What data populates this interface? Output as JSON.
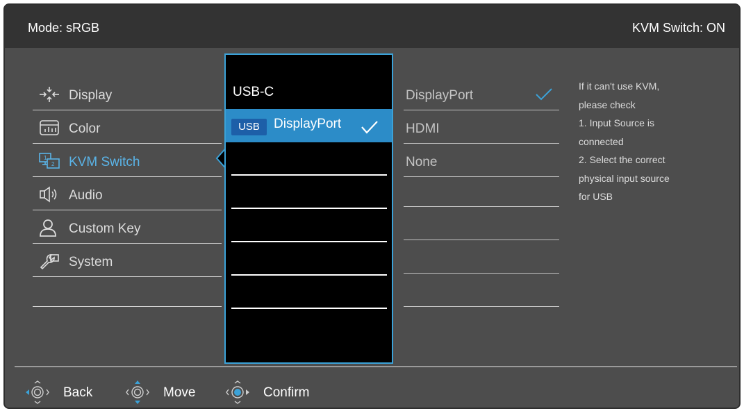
{
  "header": {
    "mode": "Mode: sRGB",
    "kvm_status": "KVM Switch: ON"
  },
  "menu": [
    {
      "label": "Display",
      "icon": "display-adjust-icon",
      "active": false
    },
    {
      "label": "Color",
      "icon": "color-icon",
      "active": false
    },
    {
      "label": "KVM Switch",
      "icon": "kvm-switch-icon",
      "active": true
    },
    {
      "label": "Audio",
      "icon": "speaker-icon",
      "active": false
    },
    {
      "label": "Custom Key",
      "icon": "person-icon",
      "active": false
    },
    {
      "label": "System",
      "icon": "wrench-icon",
      "active": false
    }
  ],
  "submenu": {
    "items": [
      {
        "label": "USB-C",
        "selected": false
      },
      {
        "badge": "USB",
        "label": "DisplayPort",
        "selected": true,
        "checked": true
      }
    ]
  },
  "options": [
    {
      "label": "DisplayPort",
      "checked": true
    },
    {
      "label": "HDMI",
      "checked": false
    },
    {
      "label": "None",
      "checked": false
    }
  ],
  "help_text": [
    "If it can't use KVM,",
    "please check",
    "1. Input Source is",
    "connected",
    "2. Select the correct",
    "physical input source",
    "for USB"
  ],
  "nav": {
    "back": "Back",
    "move": "Move",
    "confirm": "Confirm"
  },
  "colors": {
    "accent": "#3ba2d8",
    "selected_bg": "#2c8cc8",
    "badge_bg": "#1d5fa8",
    "panel_bg": "#4d4d4d",
    "topbar_bg": "#333333"
  }
}
